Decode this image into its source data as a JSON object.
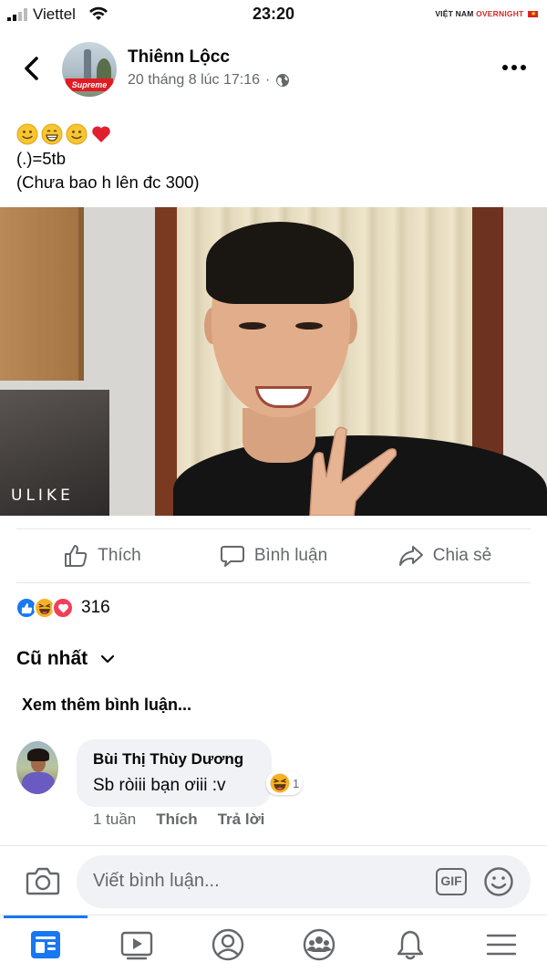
{
  "status_bar": {
    "carrier": "Viettel",
    "time": "23:20",
    "watermark_part1": "VIỆT NAM",
    "watermark_part2": "OVERNIGHT"
  },
  "post": {
    "author": "Thiênn Lộcc",
    "timestamp": "20 tháng 8 lúc 17:16",
    "separator": "·",
    "caption_line1": "(.)=5tb",
    "caption_line2": "(Chưa bao h lên đc 300)",
    "photo_watermark": "ULIKE",
    "avatar_logo": "Supreme"
  },
  "actions": {
    "like": "Thích",
    "comment": "Bình luận",
    "share": "Chia sẻ"
  },
  "reactions": {
    "count": "316"
  },
  "comments_section": {
    "sort_label": "Cũ nhất",
    "view_more": "Xem thêm bình luận..."
  },
  "comment": {
    "author": "Bùi Thị Thùy Dương",
    "text": "Sb ròiii bạn ơiii :v",
    "reaction_count": "1",
    "age": "1 tuần",
    "like": "Thích",
    "reply": "Trả lời"
  },
  "composer": {
    "placeholder": "Viết bình luận...",
    "gif_label": "GIF"
  },
  "colors": {
    "accent": "#1877f2",
    "secondary_text": "#65676b",
    "heart": "#f33e58",
    "haha": "#f7b125"
  }
}
